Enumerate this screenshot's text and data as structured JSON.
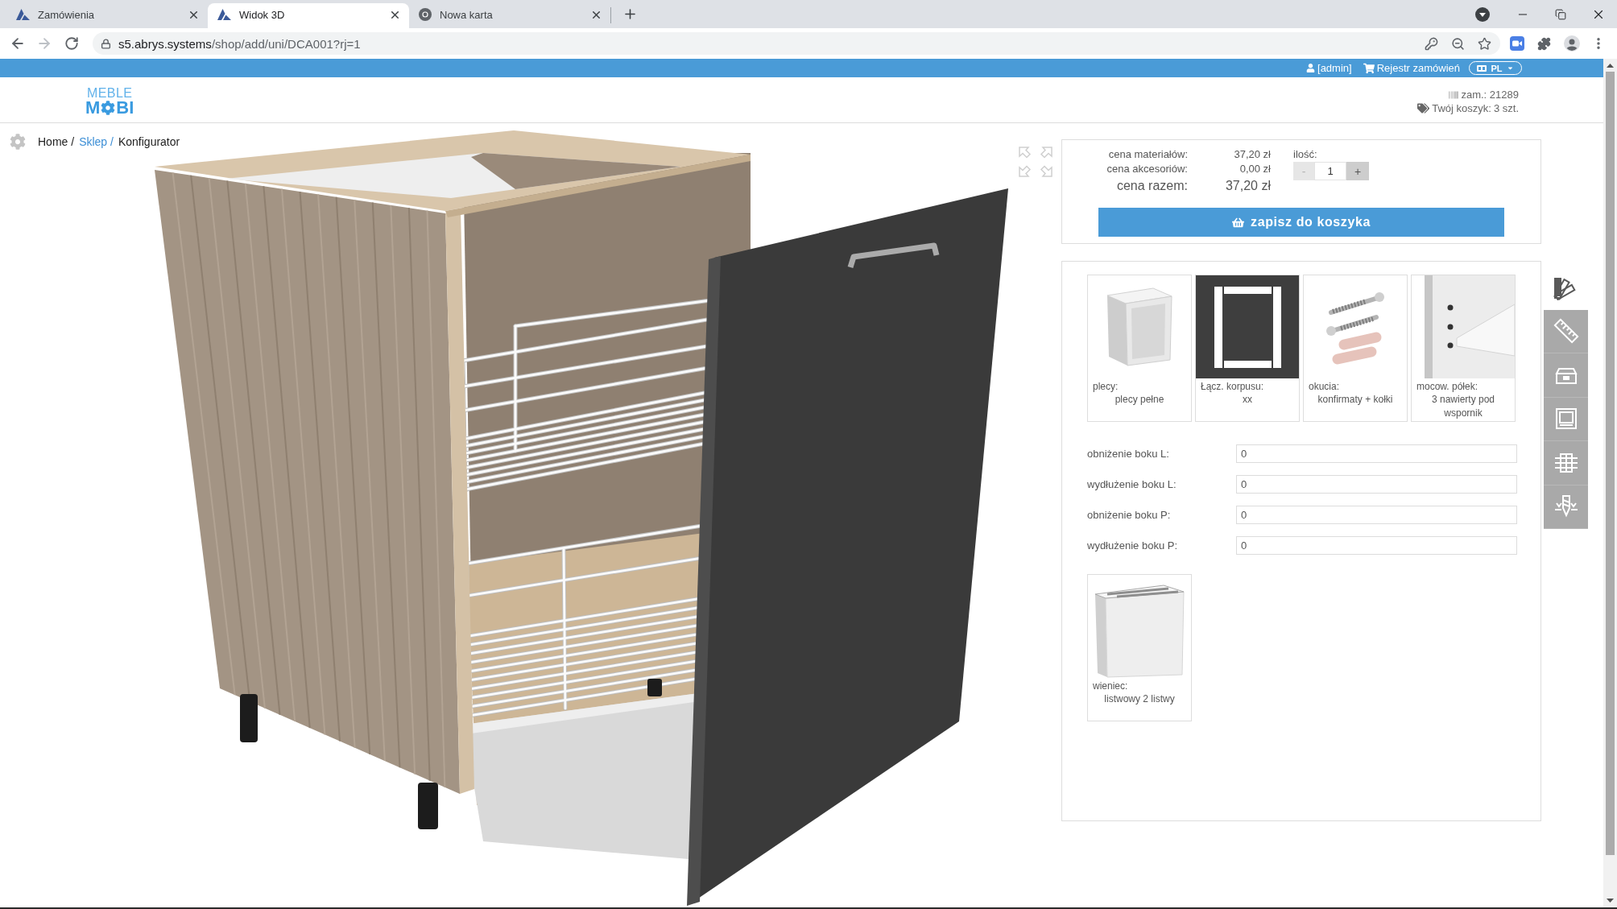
{
  "browser": {
    "tabs": [
      {
        "title": "Zamówienia",
        "kind": "site",
        "selected": false
      },
      {
        "title": "Widok 3D",
        "kind": "site",
        "selected": true
      },
      {
        "title": "Nowa karta",
        "kind": "newtab",
        "selected": false
      }
    ],
    "forward_disabled": true,
    "url_host": "s5.abrys.systems",
    "url_path": "/shop/add/uni/DCA001?rj=1"
  },
  "top_bar": {
    "user": "[admin]",
    "orders": "Rejestr zamówień",
    "language": "PL"
  },
  "header": {
    "logo": {
      "line_1": "MEBLE",
      "line_2_start": "M",
      "line_2_end": "BI"
    },
    "order": "zam.: 21289",
    "cart_label": "Twój koszyk:",
    "cart_count": "3 szt."
  },
  "breadcrumb": [
    {
      "label": "Home /",
      "link": false
    },
    {
      "label": "Sklep /",
      "link": true
    },
    {
      "label": "Konfigurator",
      "link": false
    }
  ],
  "pricing": {
    "rows": [
      {
        "label": "cena materiałów:",
        "value": "37,20 zł",
        "kind": "part"
      },
      {
        "label": "cena akcesoriów:",
        "value": "0,00 zł",
        "kind": "part"
      },
      {
        "label": "cena razem:",
        "value": "37,20 zł",
        "kind": "total"
      }
    ],
    "quantity": {
      "label": "ilość:",
      "value": "1",
      "minus": {
        "label": "-",
        "disabled": true
      },
      "plus": {
        "label": "+",
        "disabled": false
      }
    },
    "save_button": "zapisz do koszyka"
  },
  "options": [
    {
      "title": "plecy:",
      "value": "plecy pełne",
      "kind": "back"
    },
    {
      "title": "Łącz. korpusu:",
      "value": "xx",
      "kind": "joint"
    },
    {
      "title": "okucia:",
      "value": "konfirmaty + kołki",
      "kind": "fittings"
    },
    {
      "title": "mocow. półek:",
      "value": "3 nawierty pod wspornik",
      "kind": "shelf_mount"
    }
  ],
  "fields": [
    {
      "label": "obniżenie boku L:",
      "value": "0"
    },
    {
      "label": "wydłużenie boku L:",
      "value": "0"
    },
    {
      "label": "obniżenie boku P:",
      "value": "0"
    },
    {
      "label": "wydłużenie boku P:",
      "value": "0"
    }
  ],
  "extra_options": [
    {
      "title": "wieniec:",
      "value": "listwowy 2 listwy",
      "kind": "crown"
    }
  ],
  "side_tabs": [
    {
      "kind": "colors",
      "selected": true
    },
    {
      "kind": "dimensions",
      "selected": false
    },
    {
      "kind": "drawer",
      "selected": false
    },
    {
      "kind": "front",
      "selected": false
    },
    {
      "kind": "cabinet",
      "selected": false
    },
    {
      "kind": "drilling",
      "selected": false
    }
  ]
}
